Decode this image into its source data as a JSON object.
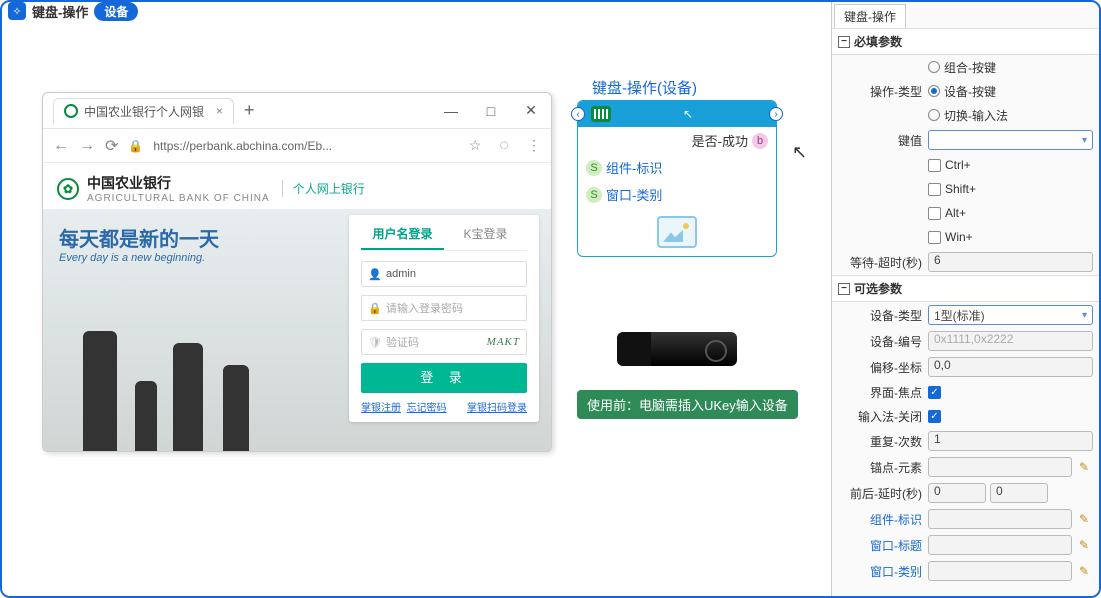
{
  "header": {
    "title": "键盘-操作",
    "pill": "设备"
  },
  "browser": {
    "tab_title": "中国农业银行个人网银",
    "url": "https://perbank.abchina.com/Eb...",
    "bank_name": "中国农业银行",
    "bank_sub": "AGRICULTURAL BANK OF CHINA",
    "bank_right": "个人网上银行",
    "hero_cn": "每天都是新的一天",
    "hero_en": "Every day is a new beginning.",
    "login": {
      "tab_user": "用户名登录",
      "tab_k": "K宝登录",
      "username": "admin",
      "pwd_placeholder": "请输入登录密码",
      "captcha_placeholder": "验证码",
      "captcha_img": "MAKT",
      "btn": "登 录",
      "link1": "掌银注册",
      "link2": "忘记密码",
      "link3": "掌银扫码登录"
    }
  },
  "flow": {
    "title": "键盘-操作(设备)",
    "out_label": "是否-成功",
    "row1": "组件-标识",
    "row2": "窗口-类别"
  },
  "ukey_tip": "使用前：电脑需插入UKey输入设备",
  "panel": {
    "tab": "键盘-操作",
    "sec_required": "必填参数",
    "sec_optional": "可选参数",
    "op_type_label": "操作-类型",
    "op_type_opts": {
      "combo": "组合-按键",
      "device": "设备-按键",
      "ime": "切换-输入法"
    },
    "key_label": "键值",
    "mod_ctrl": "Ctrl+",
    "mod_shift": "Shift+",
    "mod_alt": "Alt+",
    "mod_win": "Win+",
    "wait_label": "等待-超时(秒)",
    "wait_val": "6",
    "dev_type_label": "设备-类型",
    "dev_type_val": "1型(标准)",
    "dev_no_label": "设备-编号",
    "dev_no_ph": "0x1111,0x2222",
    "offset_label": "偏移-坐标",
    "offset_val": "0,0",
    "focus_label": "界面-焦点",
    "ime_close_label": "输入法-关闭",
    "repeat_label": "重复-次数",
    "repeat_val": "1",
    "anchor_label": "锚点-元素",
    "delay_label": "前后-延时(秒)",
    "delay_a": "0",
    "delay_b": "0",
    "comp_label": "组件-标识",
    "win_title_label": "窗口-标题",
    "win_class_label": "窗口-类别"
  }
}
